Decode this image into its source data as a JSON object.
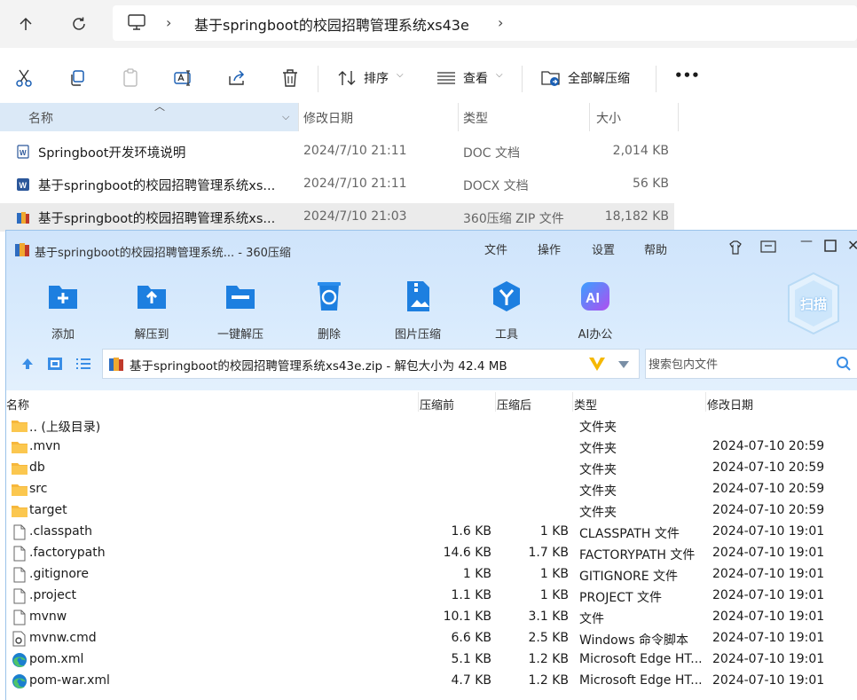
{
  "explorer": {
    "breadcrumb": "基于springboot的校园招聘管理系统xs43e",
    "toolbar": {
      "sort_label": "排序",
      "view_label": "查看",
      "extract_all_label": "全部解压缩",
      "more_label": "•••"
    },
    "columns": {
      "name": "名称",
      "modified": "修改日期",
      "type": "类型",
      "size": "大小"
    },
    "files": [
      {
        "name": "Springboot开发环境说明",
        "date": "2024/7/10 21:11",
        "type": "DOC 文档",
        "size": "2,014 KB",
        "icon": "word-doc-icon"
      },
      {
        "name": "基于springboot的校园招聘管理系统xs...",
        "date": "2024/7/10 21:11",
        "type": "DOCX 文档",
        "size": "56 KB",
        "icon": "word-docx-icon"
      },
      {
        "name": "基于springboot的校园招聘管理系统xs...",
        "date": "2024/7/10 21:03",
        "type": "360压缩 ZIP 文件",
        "size": "18,182 KB",
        "icon": "zip-archive-icon"
      }
    ]
  },
  "zip": {
    "title": "基于springboot的校园招聘管理系统... - 360压缩",
    "menu": [
      "文件",
      "操作",
      "设置",
      "帮助"
    ],
    "tools": [
      {
        "label": "添加",
        "icon": "add-icon"
      },
      {
        "label": "解压到",
        "icon": "extract-to-icon"
      },
      {
        "label": "一键解压",
        "icon": "one-click-extract-icon"
      },
      {
        "label": "删除",
        "icon": "recycle-delete-icon"
      },
      {
        "label": "图片压缩",
        "icon": "image-compress-icon"
      },
      {
        "label": "工具",
        "icon": "tools-icon"
      },
      {
        "label": "AI办公",
        "icon": "ai-office-icon"
      }
    ],
    "scan_label": "扫描",
    "path_text": "基于springboot的校园招聘管理系统xs43e.zip - 解包大小为 42.4 MB",
    "search_placeholder": "搜索包内文件",
    "columns": {
      "name": "名称",
      "before": "压缩前",
      "after": "压缩后",
      "type": "类型",
      "date": "修改日期"
    },
    "rows": [
      {
        "name": ".. (上级目录)",
        "before": "",
        "after": "",
        "type": "文件夹",
        "date": "",
        "icon": "folder-icon"
      },
      {
        "name": ".mvn",
        "before": "",
        "after": "",
        "type": "文件夹",
        "date": "2024-07-10 20:59",
        "icon": "folder-icon"
      },
      {
        "name": "db",
        "before": "",
        "after": "",
        "type": "文件夹",
        "date": "2024-07-10 20:59",
        "icon": "folder-icon"
      },
      {
        "name": "src",
        "before": "",
        "after": "",
        "type": "文件夹",
        "date": "2024-07-10 20:59",
        "icon": "folder-icon"
      },
      {
        "name": "target",
        "before": "",
        "after": "",
        "type": "文件夹",
        "date": "2024-07-10 20:59",
        "icon": "folder-icon"
      },
      {
        "name": ".classpath",
        "before": "1.6 KB",
        "after": "1 KB",
        "type": "CLASSPATH 文件",
        "date": "2024-07-10 19:01",
        "icon": "file-icon"
      },
      {
        "name": ".factorypath",
        "before": "14.6 KB",
        "after": "1.7 KB",
        "type": "FACTORYPATH 文件",
        "date": "2024-07-10 19:01",
        "icon": "file-icon"
      },
      {
        "name": ".gitignore",
        "before": "1 KB",
        "after": "1 KB",
        "type": "GITIGNORE 文件",
        "date": "2024-07-10 19:01",
        "icon": "file-icon"
      },
      {
        "name": ".project",
        "before": "1.1 KB",
        "after": "1 KB",
        "type": "PROJECT 文件",
        "date": "2024-07-10 19:01",
        "icon": "file-icon"
      },
      {
        "name": "mvnw",
        "before": "10.1 KB",
        "after": "3.1 KB",
        "type": "文件",
        "date": "2024-07-10 19:01",
        "icon": "file-icon"
      },
      {
        "name": "mvnw.cmd",
        "before": "6.6 KB",
        "after": "2.5 KB",
        "type": "Windows 命令脚本",
        "date": "2024-07-10 19:01",
        "icon": "cmd-script-icon"
      },
      {
        "name": "pom.xml",
        "before": "5.1 KB",
        "after": "1.2 KB",
        "type": "Microsoft Edge HT...",
        "date": "2024-07-10 19:01",
        "icon": "edge-icon"
      },
      {
        "name": "pom-war.xml",
        "before": "4.7 KB",
        "after": "1.2 KB",
        "type": "Microsoft Edge HT...",
        "date": "2024-07-10 19:01",
        "icon": "edge-icon"
      }
    ]
  }
}
